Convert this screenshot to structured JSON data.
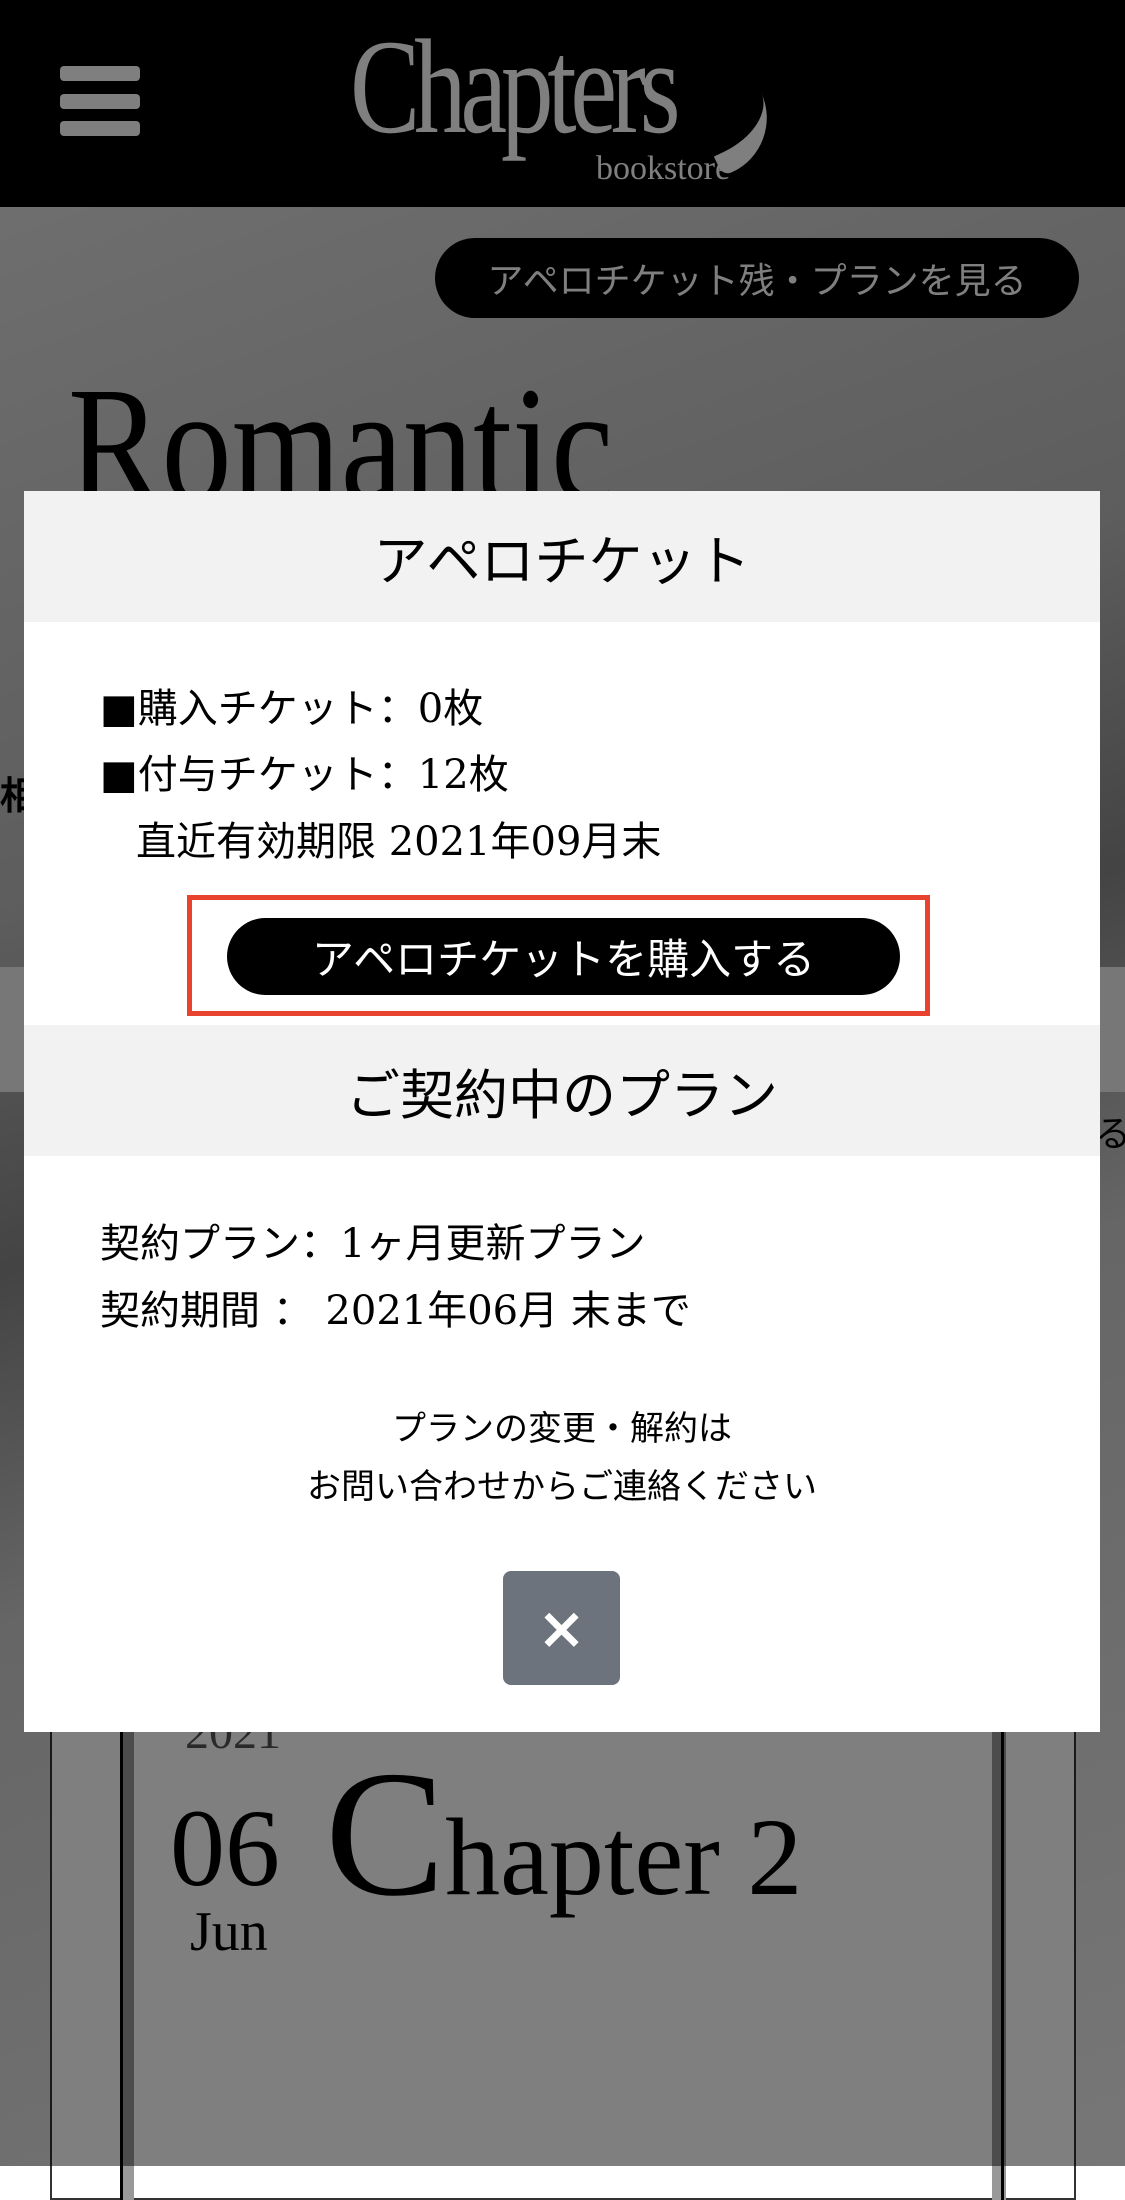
{
  "header": {
    "logo_text": "Chapters",
    "logo_sub": "bookstore",
    "menu_icon": "hamburger-icon"
  },
  "hero": {
    "plan_button": "アペロチケット残・プランを見る",
    "title": "Romantic",
    "peek_left": "相",
    "peek_right": "る"
  },
  "card": {
    "year": "2021",
    "day": "06",
    "chapter_initial": "C",
    "chapter_rest": "hapter 2",
    "month": "Jun"
  },
  "modal": {
    "ticket_title": "アペロチケット",
    "purchased": "■購入チケット：0枚",
    "granted": "■付与チケット：12枚",
    "expiry": "直近有効期限 2021年09月末",
    "buy_button": "アペロチケットを購入する",
    "plan_title": "ご契約中のプラン",
    "plan": "契約プラン：1ヶ月更新プラン",
    "period": "契約期間 ： 2021年06月 末まで",
    "note_line1": "プランの変更・解約は",
    "note_line2": "お問い合わせからご連絡ください",
    "close_label": "×",
    "highlight_color": "#e8432e"
  }
}
